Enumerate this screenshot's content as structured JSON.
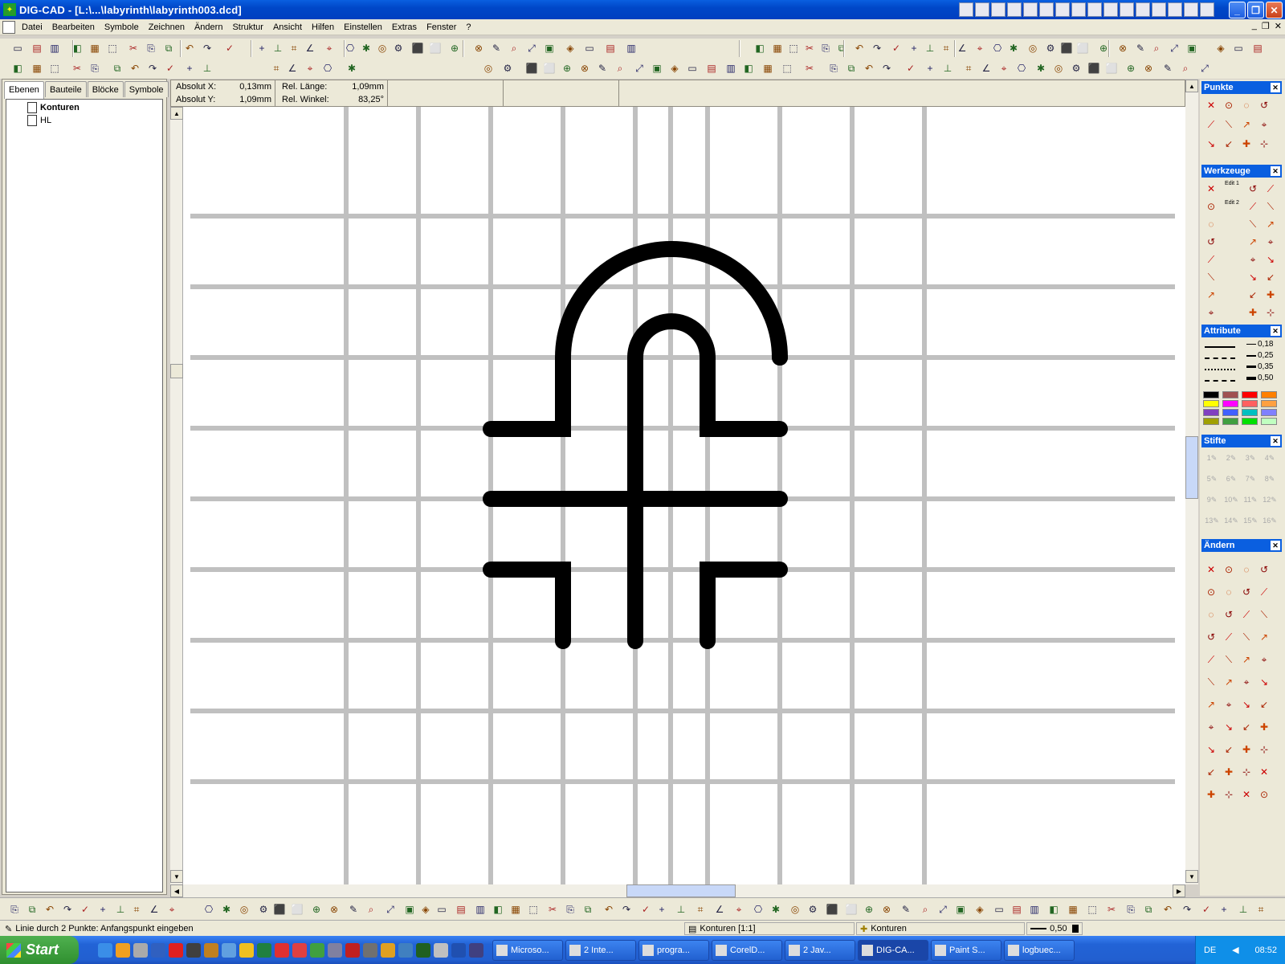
{
  "window": {
    "title": "DIG-CAD - [L:\\...\\labyrinth\\labyrinth003.dcd]"
  },
  "menu": [
    "Datei",
    "Bearbeiten",
    "Symbole",
    "Zeichnen",
    "Ändern",
    "Struktur",
    "Ansicht",
    "Hilfen",
    "Einstellen",
    "Extras",
    "Fenster",
    "?"
  ],
  "left_tabs": [
    "Ebenen",
    "Bauteile",
    "Blöcke",
    "Symbole"
  ],
  "layers": [
    "Konturen",
    "HL"
  ],
  "coords": {
    "absx_label": "Absolut X:",
    "absx_value": "0,13mm",
    "absy_label": "Absolut Y:",
    "absy_value": "1,09mm",
    "rel_len_label": "Rel. Länge:",
    "rel_len_value": "1,09mm",
    "rel_angle_label": "Rel. Winkel:",
    "rel_angle_value": "83,25°"
  },
  "panels": {
    "punkte": "Punkte",
    "werkzeuge": "Werkzeuge",
    "edit1": "Edit 1",
    "edit2": "Edit 2",
    "attribute": "Attribute",
    "line_widths": [
      "0,18",
      "0,25",
      "0,35",
      "0,50"
    ],
    "colors": [
      "#000000",
      "#a05050",
      "#ff0000",
      "#ff8000",
      "#ffff00",
      "#ff00ff",
      "#ff6060",
      "#ffa040",
      "#8040c0",
      "#4060ff",
      "#00c0c0",
      "#8080ff",
      "#a0a000",
      "#40a040",
      "#00e000",
      "#c0ffc0"
    ],
    "stifte": "Stifte",
    "pens": [
      "1",
      "2",
      "3",
      "4",
      "5",
      "6",
      "7",
      "8",
      "9",
      "10",
      "11",
      "12",
      "13",
      "14",
      "15",
      "16"
    ],
    "aendern": "Ändern"
  },
  "status": {
    "prompt": "Linie durch 2 Punkte: Anfangspunkt eingeben",
    "layer": "Konturen [1:1]",
    "layer2": "Konturen",
    "width": "0,50"
  },
  "taskbar": {
    "start": "Start",
    "tasks": [
      "Microso...",
      "2 Inte...",
      "progra...",
      "CorelD...",
      "2 Jav...",
      "DIG-CA...",
      "Paint S...",
      "logbuec..."
    ],
    "lang": "DE",
    "clock": "08:52"
  },
  "icons": {
    "minimize": "minimize-icon",
    "maximize": "maximize-icon",
    "close": "close-icon"
  }
}
